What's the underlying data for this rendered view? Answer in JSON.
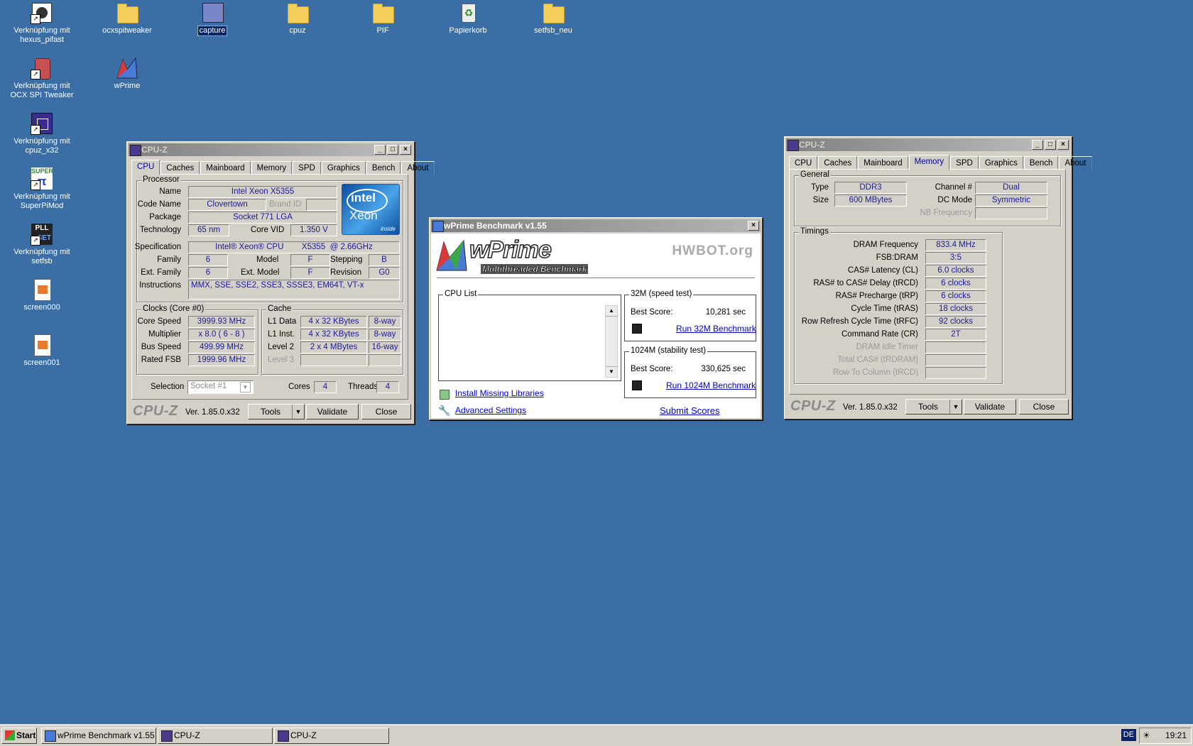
{
  "desktop": {
    "icons": [
      {
        "label": "Verknüpfung mit hexus_pifast"
      },
      {
        "label": "ocxspitweaker"
      },
      {
        "label": "capture"
      },
      {
        "label": "cpuz"
      },
      {
        "label": "PIF"
      },
      {
        "label": "Papierkorb"
      },
      {
        "label": "setfsb_neu"
      },
      {
        "label": "Verknüpfung mit OCX SPI Tweaker"
      },
      {
        "label": "wPrime"
      },
      {
        "label": "Verknüpfung mit cpuz_x32"
      },
      {
        "label": "Verknüpfung mit SuperPiMod"
      },
      {
        "label": "Verknüpfung mit setfsb"
      },
      {
        "label": "screen000"
      },
      {
        "label": "screen001"
      }
    ],
    "icon_glyphs": {
      "super": "SUPER",
      "pll": "PLL",
      "set": "SET"
    }
  },
  "cpuz1": {
    "title": "CPU-Z",
    "tabs": [
      "CPU",
      "Caches",
      "Mainboard",
      "Memory",
      "SPD",
      "Graphics",
      "Bench",
      "About"
    ],
    "processor": {
      "group": "Processor",
      "name_label": "Name",
      "name": "Intel Xeon X5355",
      "code_label": "Code Name",
      "code": "Clovertown",
      "brand_label": "Brand ID",
      "brand": "",
      "package_label": "Package",
      "package": "Socket 771 LGA",
      "tech_label": "Technology",
      "tech": "65 nm",
      "vid_label": "Core VID",
      "vid": "1.350 V",
      "spec_label": "Specification",
      "spec": "Intel® Xeon® CPU        X5355  @ 2.66GHz",
      "family_label": "Family",
      "family": "6",
      "model_label": "Model",
      "model": "F",
      "stepping_label": "Stepping",
      "stepping": "B",
      "extfam_label": "Ext. Family",
      "extfam": "6",
      "extmodel_label": "Ext. Model",
      "extmodel": "F",
      "revision_label": "Revision",
      "revision": "G0",
      "instr_label": "Instructions",
      "instr": "MMX, SSE, SSE2, SSE3, SSSE3, EM64T, VT-x",
      "logo_brand": "intel",
      "logo_product": "Xeon",
      "logo_inside": "inside"
    },
    "clocks": {
      "group": "Clocks (Core #0)",
      "core_label": "Core Speed",
      "core": "3999.93 MHz",
      "mult_label": "Multiplier",
      "mult": "x 8.0 ( 6 - 8 )",
      "bus_label": "Bus Speed",
      "bus": "499.99 MHz",
      "fsb_label": "Rated FSB",
      "fsb": "1999.96 MHz"
    },
    "cache": {
      "group": "Cache",
      "l1d_label": "L1 Data",
      "l1d": "4 x 32 KBytes",
      "l1d_way": "8-way",
      "l1i_label": "L1 Inst.",
      "l1i": "4 x 32 KBytes",
      "l1i_way": "8-way",
      "l2_label": "Level 2",
      "l2": "2 x 4 MBytes",
      "l2_way": "16-way",
      "l3_label": "Level 3",
      "l3": "",
      "l3_way": ""
    },
    "selection_label": "Selection",
    "selection": "Socket #1",
    "cores_label": "Cores",
    "cores": "4",
    "threads_label": "Threads",
    "threads": "4",
    "brand": "CPU-Z",
    "version": "Ver. 1.85.0.x32",
    "tools": "Tools",
    "validate": "Validate",
    "close": "Close"
  },
  "wprime": {
    "title": "wPrime Benchmark v1.55",
    "logo": "wPrime",
    "logo_sub": "Multithreaded Benchmark",
    "hwbot": "HWBOT.org",
    "cpu_list": "CPU List",
    "t32_group": "32M (speed test)",
    "t32_best_label": "Best Score:",
    "t32_best": "10,281 sec",
    "t32_run": "Run 32M Benchmark",
    "t1024_group": "1024M (stability test)",
    "t1024_best_label": "Best Score:",
    "t1024_best": "330,625 sec",
    "t1024_run": "Run 1024M Benchmark",
    "install": "Install Missing Libraries",
    "advanced": "Advanced Settings",
    "submit": "Submit Scores"
  },
  "cpuz2": {
    "title": "CPU-Z",
    "tabs": [
      "CPU",
      "Caches",
      "Mainboard",
      "Memory",
      "SPD",
      "Graphics",
      "Bench",
      "About"
    ],
    "general": {
      "group": "General",
      "type_label": "Type",
      "type": "DDR3",
      "size_label": "Size",
      "size": "600 MBytes",
      "channel_label": "Channel #",
      "channel": "Dual",
      "dc_label": "DC Mode",
      "dc": "Symmetric",
      "nb_label": "NB Frequency",
      "nb": ""
    },
    "timings": {
      "group": "Timings",
      "rows": [
        {
          "label": "DRAM Frequency",
          "value": "833.4 MHz"
        },
        {
          "label": "FSB:DRAM",
          "value": "3:5"
        },
        {
          "label": "CAS# Latency (CL)",
          "value": "6.0 clocks"
        },
        {
          "label": "RAS# to CAS# Delay (tRCD)",
          "value": "6 clocks"
        },
        {
          "label": "RAS# Precharge (tRP)",
          "value": "6 clocks"
        },
        {
          "label": "Cycle Time (tRAS)",
          "value": "18 clocks"
        },
        {
          "label": "Row Refresh Cycle Time (tRFC)",
          "value": "92 clocks"
        },
        {
          "label": "Command Rate (CR)",
          "value": "2T"
        },
        {
          "label": "DRAM Idle Timer",
          "value": ""
        },
        {
          "label": "Total CAS# (tRDRAM)",
          "value": ""
        },
        {
          "label": "Row To Column (tRCD)",
          "value": ""
        }
      ]
    },
    "brand": "CPU-Z",
    "version": "Ver. 1.85.0.x32",
    "tools": "Tools",
    "validate": "Validate",
    "close": "Close"
  },
  "taskbar": {
    "start": "Start",
    "items": [
      "wPrime Benchmark v1.55",
      "CPU-Z",
      "CPU-Z"
    ],
    "lang": "DE",
    "clock": "19:21"
  }
}
